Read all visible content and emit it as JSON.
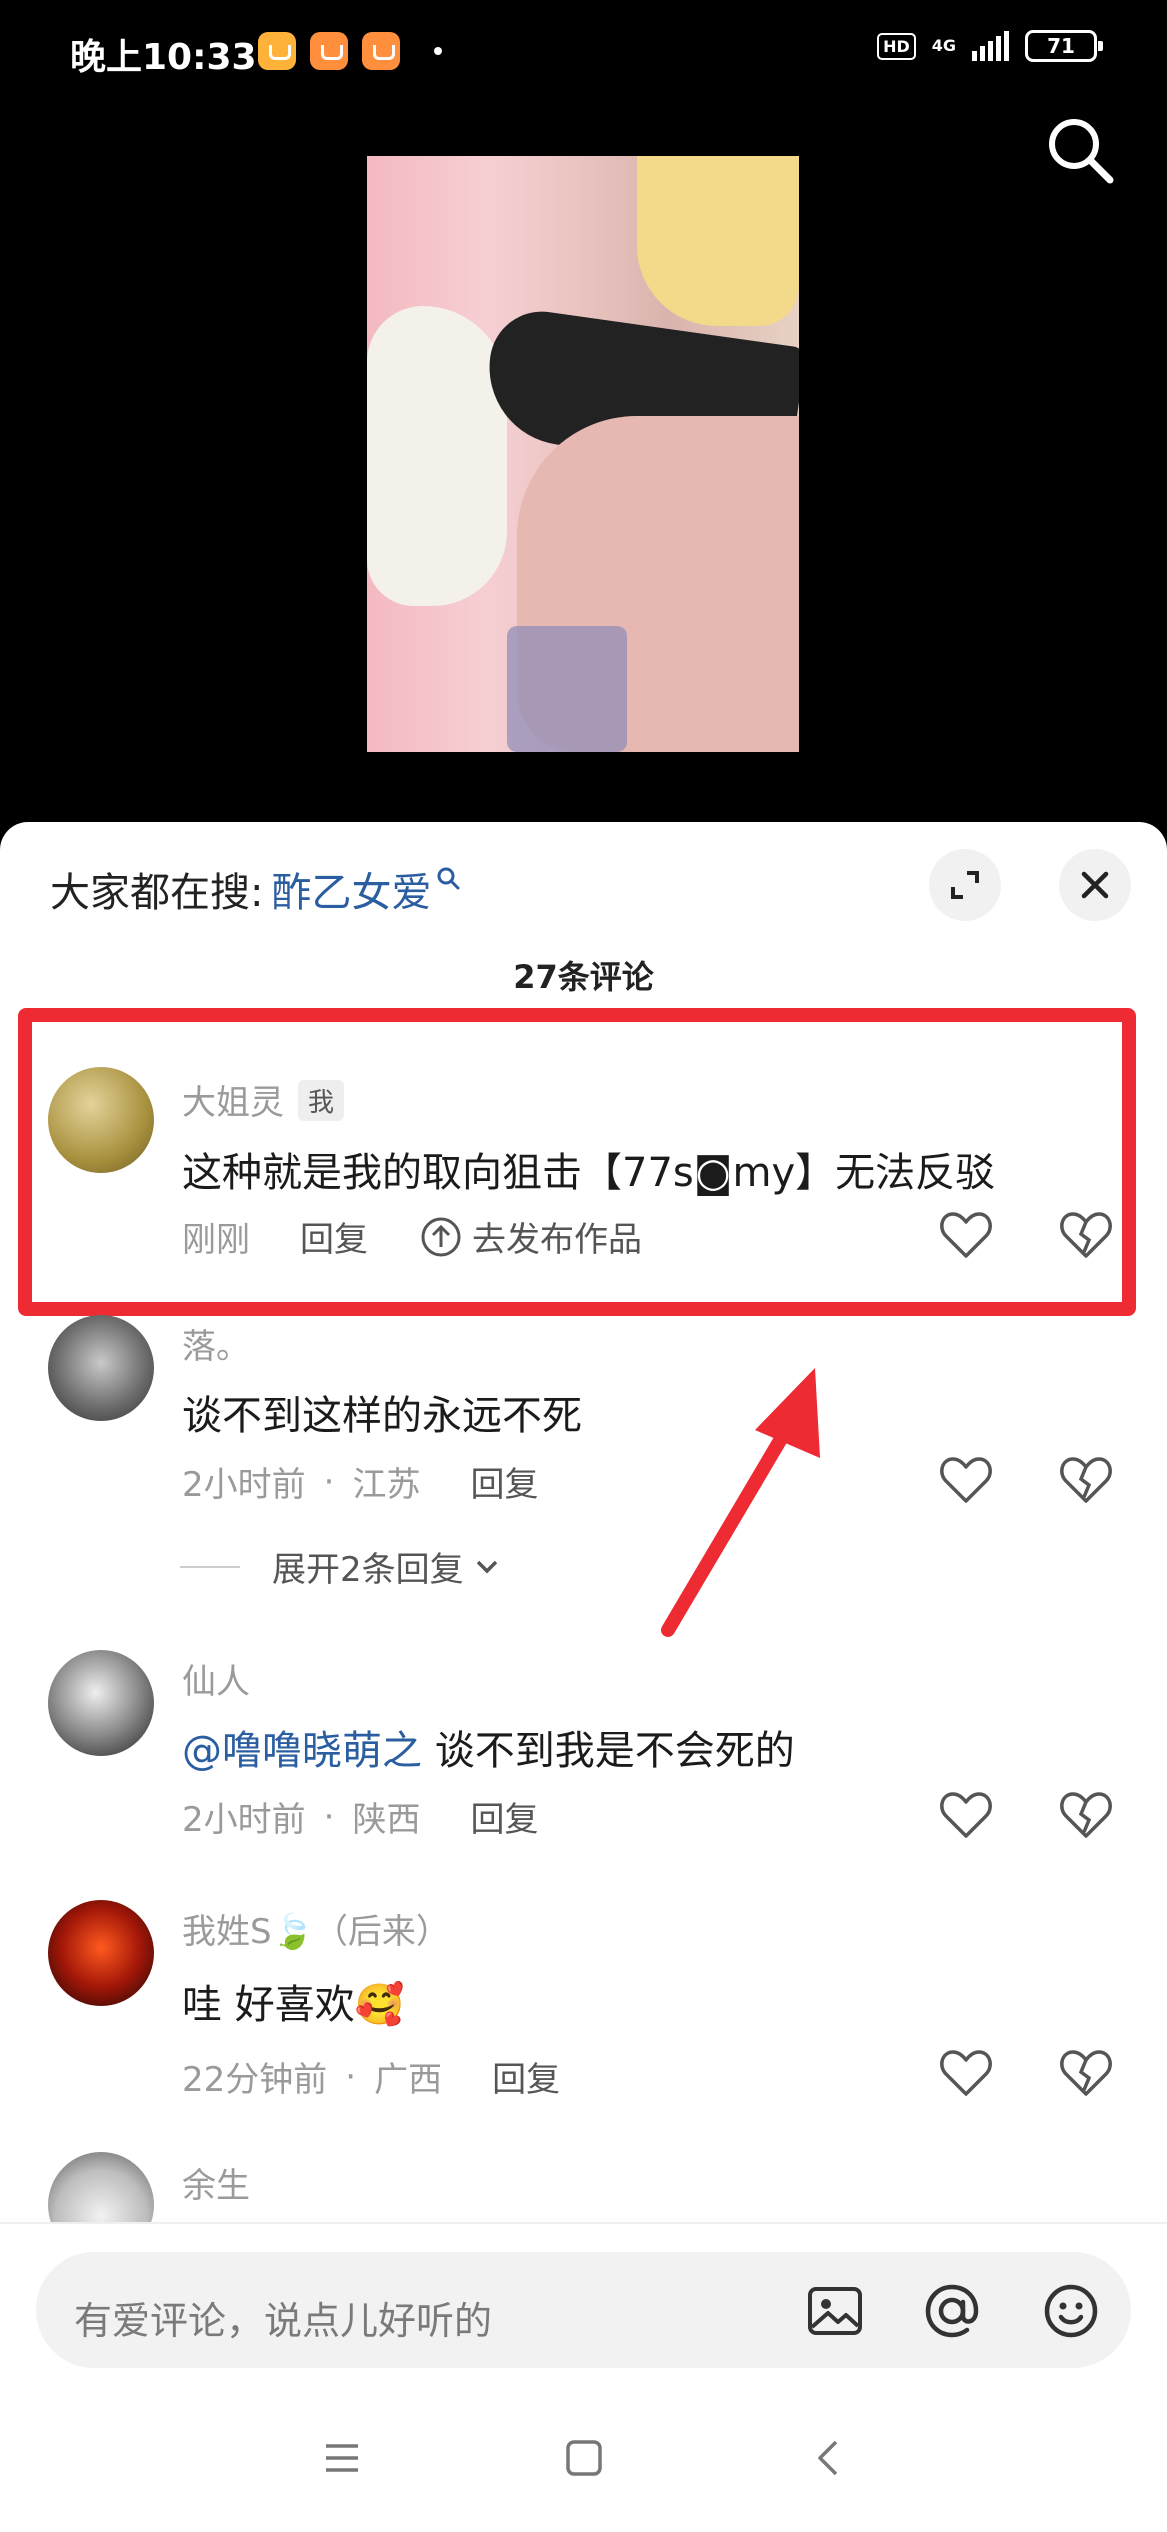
{
  "status_bar": {
    "time": "晚上10:33",
    "hd": "HD",
    "network": "4G",
    "battery": "71"
  },
  "sheet": {
    "hot_search_prefix": "大家都在搜:",
    "hot_search_term": "酢乙女爱",
    "comment_count": "27条评论"
  },
  "comments": [
    {
      "name": "大姐灵",
      "tag": "我",
      "text": "这种就是我的取向狙击【77s◙my】无法反驳",
      "time": "刚刚",
      "reply": "回复",
      "publish": "去发布作品"
    },
    {
      "name": "落。",
      "text": "谈不到这样的永远不死",
      "time": "2小时前",
      "sep": "·",
      "location": "江苏",
      "reply": "回复",
      "expand": "展开2条回复"
    },
    {
      "name": "仙人",
      "mention": "@噜噜晓萌之",
      "text": " 谈不到我是不会死的",
      "time": "2小时前",
      "sep": "·",
      "location": "陕西",
      "reply": "回复"
    },
    {
      "name": "我姓S🍃（后来）",
      "text": "哇 好喜欢🥰",
      "time": "22分钟前",
      "sep": "·",
      "location": "广西",
      "reply": "回复"
    },
    {
      "name": "余生"
    }
  ],
  "input": {
    "placeholder": "有爱评论，说点儿好听的"
  },
  "colors": {
    "accent_blue": "#2a5ea0",
    "highlight_red": "#ee2b33"
  }
}
